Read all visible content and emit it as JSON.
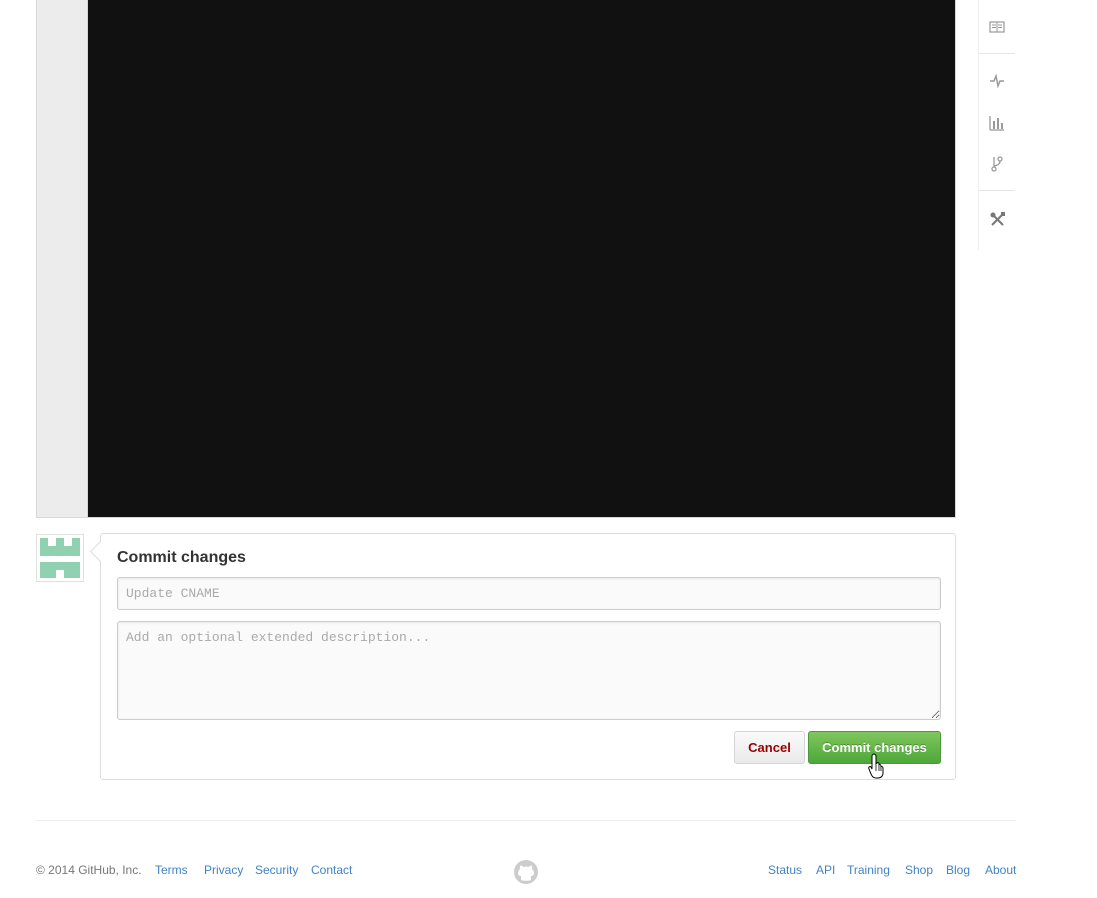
{
  "commit": {
    "title": "Commit changes",
    "summary_placeholder": "Update CNAME",
    "description_placeholder": "Add an optional extended description...",
    "cancel_label": "Cancel",
    "commit_label": "Commit changes"
  },
  "repo_nav": {
    "icons": [
      "wiki-icon",
      "pulse-icon",
      "graphs-icon",
      "network-icon",
      "settings-icon"
    ]
  },
  "footer": {
    "copyright": "© 2014 GitHub, Inc.",
    "left_links": [
      "Terms",
      "Privacy",
      "Security",
      "Contact"
    ],
    "right_links": [
      "Status",
      "API",
      "Training",
      "Shop",
      "Blog",
      "About"
    ]
  },
  "colors": {
    "editor_bg": "#111111",
    "commit_button": "#5cb547",
    "cancel_text": "#990000",
    "link": "#4183c4",
    "avatar": "#8fd1b1"
  }
}
